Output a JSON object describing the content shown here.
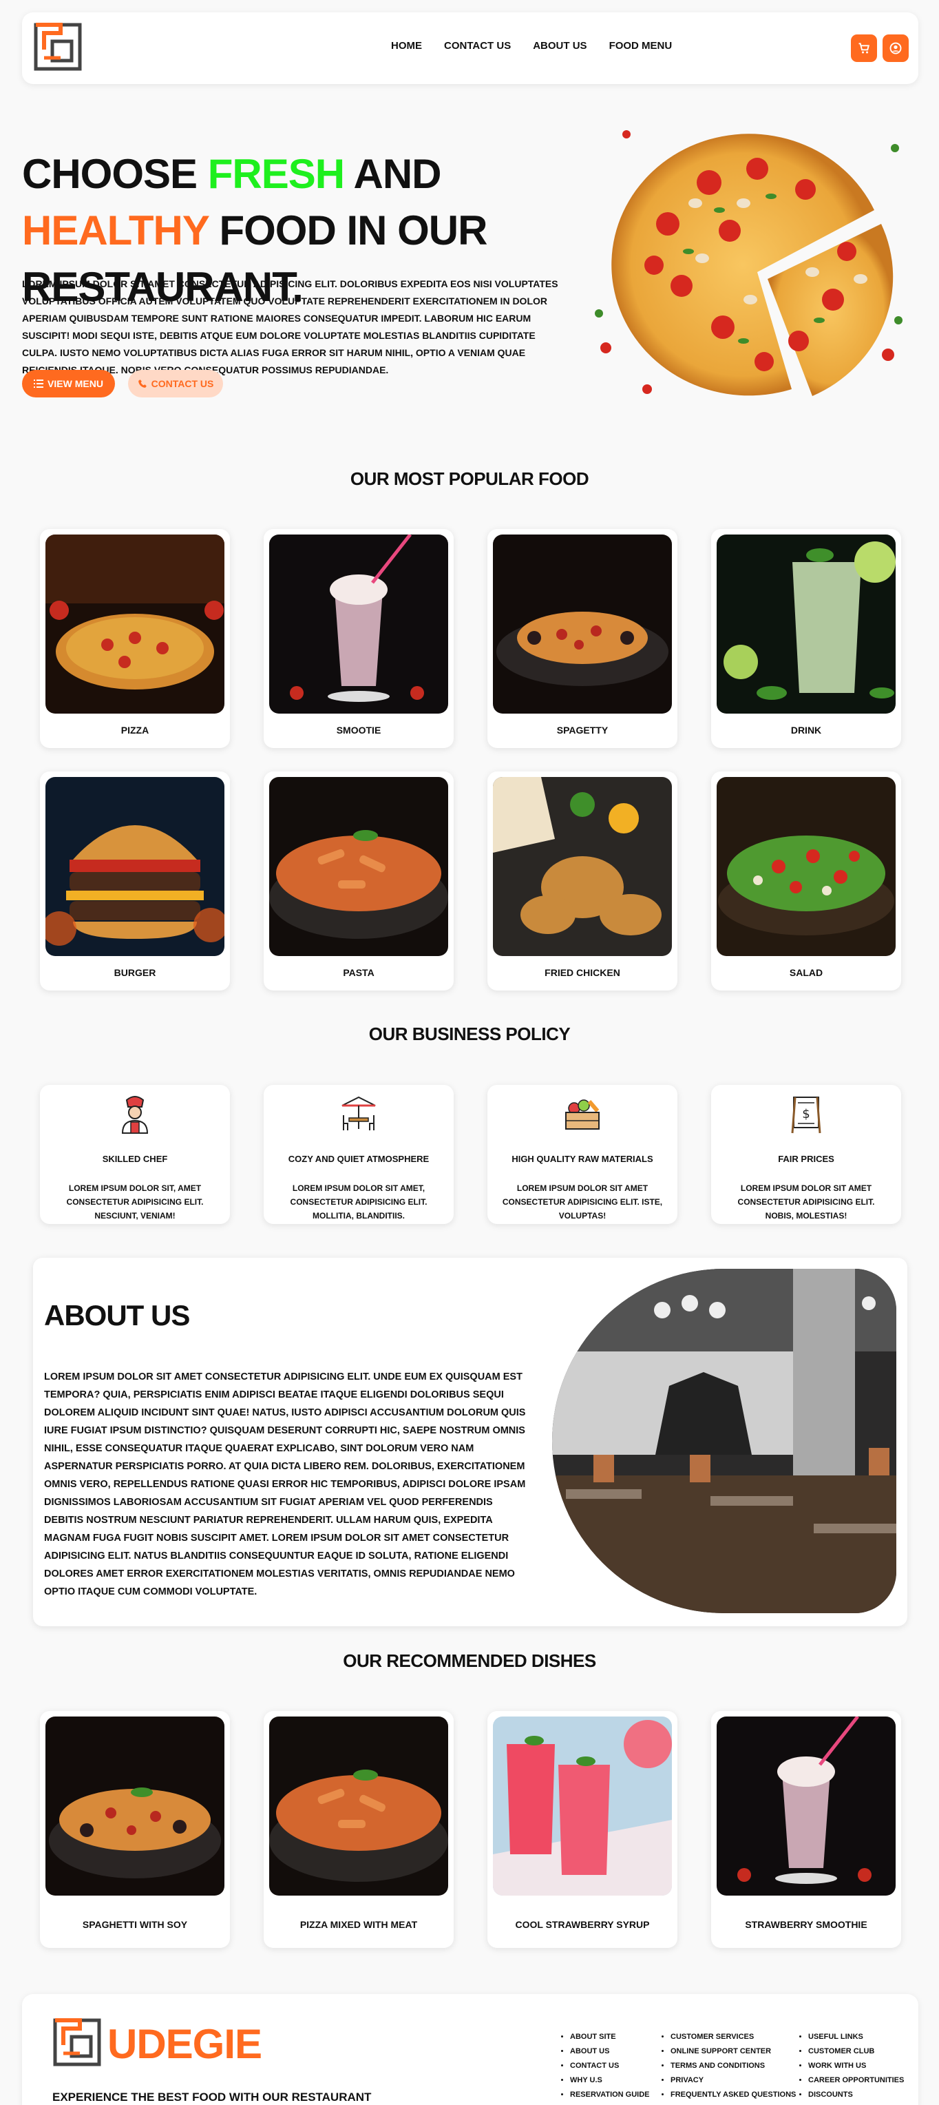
{
  "nav": {
    "links": [
      "HOME",
      "CONTACT US",
      "ABOUT US",
      "FOOD MENU"
    ],
    "cart_icon": "cart-icon",
    "user_icon": "user-icon"
  },
  "hero": {
    "title_part1": "CHOOSE ",
    "title_fresh": "FRESH",
    "title_part2": " AND ",
    "title_healthy": "HEALTHY",
    "title_part3": " FOOD IN OUR RESTAURANT.",
    "text": "LOREM IPSUM DOLOR SIT AMET CONSECTETUR ADIPISICING ELIT. DOLORIBUS EXPEDITA EOS NISI VOLUPTATES VOLUPTATIBUS OFFICIA AUTEM VOLUPTATEM QUO VOLUPTATE REPREHENDERIT EXERCITATIONEM IN DOLOR APERIAM QUIBUSDAM TEMPORE SUNT RATIONE MAIORES CONSEQUATUR IMPEDIT. LABORUM HIC EARUM SUSCIPIT! MODI SEQUI ISTE, DEBITIS ATQUE EUM DOLORE VOLUPTATE MOLESTIAS BLANDITIIS CUPIDITATE CULPA. IUSTO NEMO VOLUPTATIBUS DICTA ALIAS FUGA ERROR SIT HARUM NIHIL, OPTIO A VENIAM QUAE REICIENDIS ITAQUE. NOBIS VERO CONSEQUATUR POSSIMUS REPUDIANDAE.",
    "btn_menu": "VIEW MENU",
    "btn_contact": "CONTACT US"
  },
  "popular": {
    "title": "OUR MOST POPULAR FOOD",
    "items": [
      "PIZZA",
      "SMOOTIE",
      "SPAGETTY",
      "DRINK",
      "BURGER",
      "PASTA",
      "FRIED CHICKEN",
      "SALAD"
    ]
  },
  "policy": {
    "title": "OUR BUSINESS POLICY",
    "items": [
      {
        "title": "SKILLED CHEF",
        "text": "LOREM IPSUM DOLOR SIT, AMET CONSECTETUR ADIPISICING ELIT. NESCIUNT, VENIAM!"
      },
      {
        "title": "COZY AND QUIET ATMOSPHERE",
        "text": "LOREM IPSUM DOLOR SIT AMET, CONSECTETUR ADIPISICING ELIT. MOLLITIA, BLANDITIIS."
      },
      {
        "title": "HIGH QUALITY RAW MATERIALS",
        "text": "LOREM IPSUM DOLOR SIT AMET CONSECTETUR ADIPISICING ELIT. ISTE, VOLUPTAS!"
      },
      {
        "title": "FAIR PRICES",
        "text": "LOREM IPSUM DOLOR SIT AMET CONSECTETUR ADIPISICING ELIT. NOBIS, MOLESTIAS!"
      }
    ]
  },
  "about": {
    "title": "ABOUT US",
    "text": "LOREM IPSUM DOLOR SIT AMET CONSECTETUR ADIPISICING ELIT. UNDE EUM EX QUISQUAM EST TEMPORA? QUIA, PERSPICIATIS ENIM ADIPISCI BEATAE ITAQUE ELIGENDI DOLORIBUS SEQUI DOLOREM ALIQUID INCIDUNT SINT QUAE! NATUS, IUSTO ADIPISCI ACCUSANTIUM DOLORUM QUIS IURE FUGIAT IPSUM DISTINCTIO? QUISQUAM DESERUNT CORRUPTI HIC, SAEPE NOSTRUM OMNIS NIHIL, ESSE CONSEQUATUR ITAQUE QUAERAT EXPLICABO, SINT DOLORUM VERO NAM ASPERNATUR PERSPICIATIS PORRO. AT QUIA DICTA LIBERO REM. DOLORIBUS, EXERCITATIONEM OMNIS VERO, REPELLENDUS RATIONE QUASI ERROR HIC TEMPORIBUS, ADIPISCI DOLORE IPSAM DIGNISSIMOS LABORIOSAM ACCUSANTIUM SIT FUGIAT APERIAM VEL QUOD PERFERENDIS DEBITIS NOSTRUM NESCIUNT PARIATUR REPREHENDERIT. ULLAM HARUM QUIS, EXPEDITA MAGNAM FUGA FUGIT NOBIS SUSCIPIT AMET. LOREM IPSUM DOLOR SIT AMET CONSECTETUR ADIPISICING ELIT. NATUS BLANDITIIS CONSEQUUNTUR EAQUE ID SOLUTA, RATIONE ELIGENDI DOLORES AMET ERROR EXERCITATIONEM MOLESTIAS VERITATIS, OMNIS REPUDIANDAE NEMO OPTIO ITAQUE CUM COMMODI VOLUPTATE."
  },
  "recommended": {
    "title": "OUR RECOMMENDED DISHES",
    "items": [
      "SPAGHETTI WITH SOY",
      "PIZZA MIXED WITH MEAT",
      "COOL STRAWBERRY SYRUP",
      "STRAWBERRY SMOOTHIE"
    ]
  },
  "footer": {
    "brand": "UDEGIE",
    "tagline": "EXPERIENCE THE BEST FOOD WITH OUR RESTAURANT",
    "col1": [
      "ABOUT SITE",
      "ABOUT US",
      "CONTACT US",
      "WHY U.S",
      "RESERVATION GUIDE"
    ],
    "col2": [
      "CUSTOMER SERVICES",
      "ONLINE SUPPORT CENTER",
      "TERMS AND CONDITIONS",
      "PRIVACY",
      "FREQUENTLY ASKED QUESTIONS"
    ],
    "col3": [
      "USEFUL LINKS",
      "CUSTOMER CLUB",
      "WORK WITH US",
      "CAREER OPPORTUNITIES",
      "DISCOUNTS"
    ]
  },
  "colors": {
    "accent": "#ff6a1f",
    "fresh": "#1eef1e",
    "background": "#f9f9f9"
  }
}
